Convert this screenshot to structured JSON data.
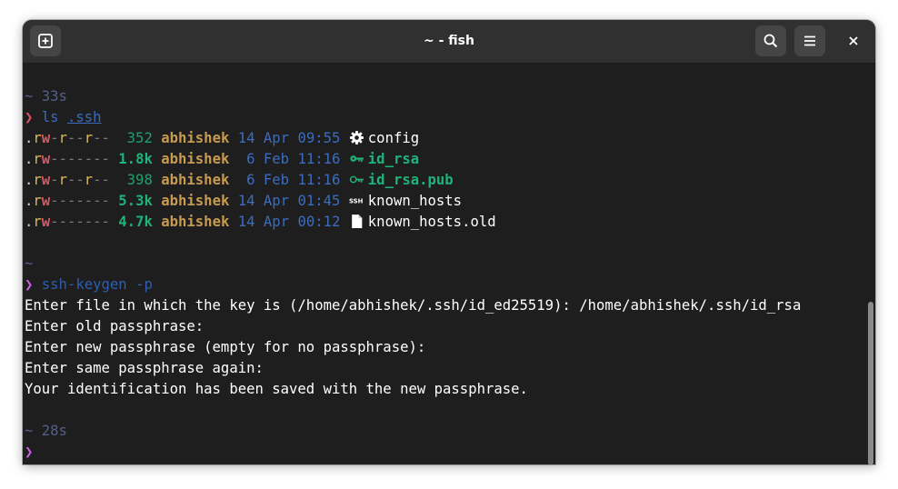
{
  "window": {
    "title": "~ - fish"
  },
  "terminal": {
    "prompt1": {
      "tilde": "~",
      "duration": "33s",
      "chevron": "❯",
      "cmd": "ls",
      "arg": ".ssh"
    },
    "files": [
      {
        "p1": "r",
        "p2": "w",
        "p3": "-",
        "p4": "r",
        "p5": "-",
        "p6": "-",
        "p7": "r",
        "p8": "-",
        "p9": "-",
        "size": "352",
        "size_style": "plain",
        "owner": "abhishek",
        "date": "14 Apr 09:55",
        "icon": "gear-icon",
        "name": "config",
        "name_style": "plain"
      },
      {
        "p1": "r",
        "p2": "w",
        "p3": "-",
        "p4": "-",
        "p5": "-",
        "p6": "-",
        "p7": "-",
        "p8": "-",
        "p9": "-",
        "size": "1.8k",
        "size_style": "bold",
        "owner": "abhishek",
        "date": " 6 Feb 11:16",
        "icon": "key-icon",
        "name": "id_rsa",
        "name_style": "key"
      },
      {
        "p1": "r",
        "p2": "w",
        "p3": "-",
        "p4": "r",
        "p5": "-",
        "p6": "-",
        "p7": "r",
        "p8": "-",
        "p9": "-",
        "size": "398",
        "size_style": "plain",
        "owner": "abhishek",
        "date": " 6 Feb 11:16",
        "icon": "key-outline-icon",
        "name": "id_rsa.pub",
        "name_style": "key"
      },
      {
        "p1": "r",
        "p2": "w",
        "p3": "-",
        "p4": "-",
        "p5": "-",
        "p6": "-",
        "p7": "-",
        "p8": "-",
        "p9": "-",
        "size": "5.3k",
        "size_style": "bold",
        "owner": "abhishek",
        "date": "14 Apr 01:45",
        "icon": "ssh-icon",
        "name": "known_hosts",
        "name_style": "plain"
      },
      {
        "p1": "r",
        "p2": "w",
        "p3": "-",
        "p4": "-",
        "p5": "-",
        "p6": "-",
        "p7": "-",
        "p8": "-",
        "p9": "-",
        "size": "4.7k",
        "size_style": "bold",
        "owner": "abhishek",
        "date": "14 Apr 00:12",
        "icon": "file-icon",
        "name": "known_hosts.old",
        "name_style": "plain"
      }
    ],
    "prompt2": {
      "tilde": "~",
      "chevron": "❯",
      "cmd": "ssh-keygen",
      "arg": "-p"
    },
    "output": [
      "Enter file in which the key is (/home/abhishek/.ssh/id_ed25519): /home/abhishek/.ssh/id_rsa",
      "Enter old passphrase:",
      "Enter new passphrase (empty for no passphrase):",
      "Enter same passphrase again:",
      "Your identification has been saved with the new passphrase."
    ],
    "prompt3": {
      "tilde": "~",
      "duration": "28s",
      "chevron": "❯"
    }
  },
  "icons": {
    "new_tab": "new-tab-icon",
    "search": "search-icon",
    "menu": "hamburger-menu-icon",
    "close": "close-icon"
  }
}
